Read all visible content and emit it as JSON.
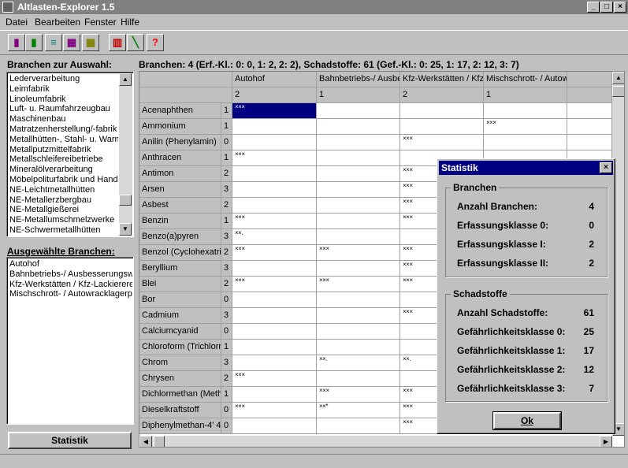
{
  "window": {
    "title": "Altlasten-Explorer  1.5",
    "min": "_",
    "max": "□",
    "close": "×"
  },
  "menu": [
    "Datei",
    "Bearbeiten",
    "Fenster",
    "Hilfe"
  ],
  "toolbar": {
    "buttons": [
      {
        "name": "tool-1-icon",
        "glyph": "▮",
        "color": "#800080"
      },
      {
        "name": "tool-2-icon",
        "glyph": "▮",
        "color": "#008000"
      },
      {
        "name": "tool-3-icon",
        "glyph": "≡",
        "color": "#008080"
      },
      {
        "name": "tool-4-icon",
        "glyph": "▦",
        "color": "#800080"
      },
      {
        "name": "tool-5-icon",
        "glyph": "▦",
        "color": "#808000"
      },
      {
        "name": "book-icon",
        "glyph": "▥",
        "color": "#c00000"
      },
      {
        "name": "pen-icon",
        "glyph": "╲",
        "color": "#008000"
      },
      {
        "name": "help-icon",
        "glyph": "?",
        "color": "#ff0000"
      }
    ]
  },
  "branchen_auswahl": {
    "label": "Branchen zur Auswahl:",
    "items": [
      "Lederverarbeitung",
      "Leimfabrik",
      "Linoleumfabrik",
      "Luft- u. Raumfahrzeugbau",
      "Maschinenbau",
      "Matratzenherstellung/-fabrik",
      "Metallhütten-, Stahl- u. Warmw",
      "Metallputzmittelfabrik",
      "Metallschleifereibetriebe",
      "Mineralölverarbeitung",
      "Möbelpoliturfabrik und Handlu",
      "NE-Leichtmetallhütten",
      "NE-Metallerzbergbau",
      "NE-Metallgießerei",
      "NE-Metallumschmelzwerke",
      "NE-Schwermetallhütten"
    ]
  },
  "ausgewaehlte": {
    "label": "Ausgewählte Branchen:",
    "items": [
      "Autohof",
      "Bahnbetriebs-/ Ausbesserungswe",
      "Kfz-Werkstätten / Kfz-Lackierere",
      "Mischschrott- / Autowracklagerp"
    ]
  },
  "statistik_button": "Statistik",
  "summary": "Branchen: 4 (Erf.-Kl.: 0: 0, 1: 2, 2: 2), Schadstoffe: 61 (Gef.-Kl.: 0: 25, 1: 17, 2: 12, 3: 7)",
  "grid": {
    "columns": [
      "Autohof",
      "Bahnbetriebs-/ Ausbe",
      "Kfz-Werkstätten / Kfz",
      "Mischschrott- / Autow",
      ""
    ],
    "classes": [
      "2",
      "1",
      "2",
      "1",
      ""
    ],
    "rows": [
      {
        "name": "Acenaphthen",
        "k": "1",
        "m": [
          "×××",
          "",
          "",
          "",
          ""
        ]
      },
      {
        "name": "Ammonium",
        "k": "1",
        "m": [
          "",
          "",
          "",
          "×××",
          ""
        ]
      },
      {
        "name": "Anilin (Phenylamin)",
        "k": "0",
        "m": [
          "",
          "",
          "×××",
          "",
          ""
        ]
      },
      {
        "name": "Anthracen",
        "k": "1",
        "m": [
          "×××",
          "",
          "",
          "",
          ""
        ]
      },
      {
        "name": "Antimon",
        "k": "2",
        "m": [
          "",
          "",
          "×××",
          "",
          ""
        ]
      },
      {
        "name": "Arsen",
        "k": "3",
        "m": [
          "",
          "",
          "×××",
          "",
          ""
        ]
      },
      {
        "name": "Asbest",
        "k": "2",
        "m": [
          "",
          "",
          "×××",
          "",
          ""
        ]
      },
      {
        "name": "Benzin",
        "k": "1",
        "m": [
          "×××",
          "",
          "×××",
          "",
          ""
        ]
      },
      {
        "name": "Benzo(a)pyren",
        "k": "3",
        "m": [
          "××.",
          "",
          "",
          "",
          ""
        ]
      },
      {
        "name": "Benzol (Cyclohexatrie",
        "k": "2",
        "m": [
          "×××",
          "×××",
          "×××",
          "",
          ""
        ]
      },
      {
        "name": "Beryllium",
        "k": "3",
        "m": [
          "",
          "",
          "×××",
          "",
          ""
        ]
      },
      {
        "name": "Blei",
        "k": "2",
        "m": [
          "×××",
          "×××",
          "×××",
          "",
          ""
        ]
      },
      {
        "name": "Bor",
        "k": "0",
        "m": [
          "",
          "",
          "",
          "",
          ""
        ]
      },
      {
        "name": "Cadmium",
        "k": "3",
        "m": [
          "",
          "",
          "×××",
          "",
          ""
        ]
      },
      {
        "name": "Calciumcyanid",
        "k": "0",
        "m": [
          "",
          "",
          "",
          "",
          ""
        ]
      },
      {
        "name": "Chloroform (Trichlorm",
        "k": "1",
        "m": [
          "",
          "",
          "",
          "",
          ""
        ]
      },
      {
        "name": "Chrom",
        "k": "3",
        "m": [
          "",
          "××.",
          "××.",
          "",
          ""
        ]
      },
      {
        "name": "Chrysen",
        "k": "2",
        "m": [
          "×××",
          "",
          "",
          "",
          ""
        ]
      },
      {
        "name": "Dichlormethan (Meth",
        "k": "1",
        "m": [
          "",
          "×××",
          "×××",
          "",
          ""
        ]
      },
      {
        "name": "Dieselkraftstoff",
        "k": "0",
        "m": [
          "×××",
          "××*",
          "×××",
          "",
          ""
        ]
      },
      {
        "name": "Diphenylmethan-4' 4'",
        "k": "0",
        "m": [
          "",
          "",
          "×××",
          "",
          ""
        ]
      }
    ]
  },
  "dialog": {
    "title": "Statistik",
    "branchen": {
      "label": "Branchen",
      "rows": [
        {
          "label": "Anzahl Branchen:",
          "value": "4"
        },
        {
          "label": "Erfassungsklasse 0:",
          "value": "0"
        },
        {
          "label": "Erfassungsklasse I:",
          "value": "2"
        },
        {
          "label": "Erfassungsklasse II:",
          "value": "2"
        }
      ]
    },
    "schadstoffe": {
      "label": "Schadstoffe",
      "rows": [
        {
          "label": "Anzahl Schadstoffe:",
          "value": "61"
        },
        {
          "label": "Gefährlichkeitsklasse 0:",
          "value": "25"
        },
        {
          "label": "Gefährlichkeitsklasse 1:",
          "value": "17"
        },
        {
          "label": "Gefährlichkeitsklasse 2:",
          "value": "12"
        },
        {
          "label": "Gefährlichkeitsklasse 3:",
          "value": "7"
        }
      ]
    },
    "ok": "Ok"
  }
}
